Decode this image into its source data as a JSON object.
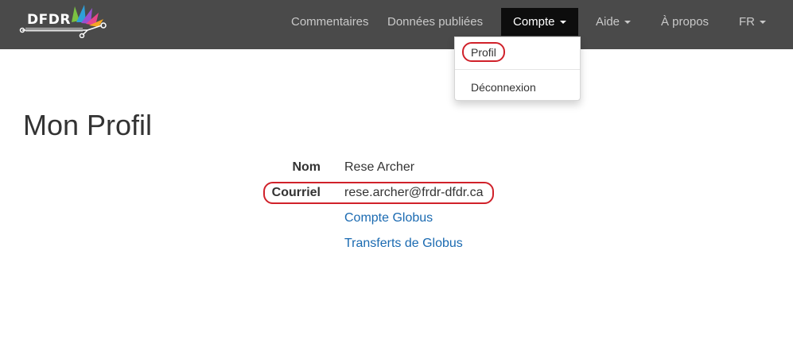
{
  "brand": {
    "logo_text": "DFDR"
  },
  "nav": {
    "items": [
      "Commentaires",
      "Données publiées"
    ],
    "account": "Compte",
    "help": "Aide",
    "about": "À propos",
    "language": "FR"
  },
  "account_menu": {
    "profile": "Profil",
    "logout": "Déconnexion"
  },
  "page": {
    "title": "Mon Profil",
    "name_label": "Nom",
    "name_value": "Rese Archer",
    "email_label": "Courriel",
    "email_value": "rese.archer@frdr-dfdr.ca",
    "links": [
      "Compte Globus",
      "Transferts de Globus"
    ]
  },
  "colors": {
    "navbar": "#4a4a4a",
    "active_tab": "#0d0d0d",
    "link": "#1a6ab1",
    "highlight": "#d0212a"
  }
}
